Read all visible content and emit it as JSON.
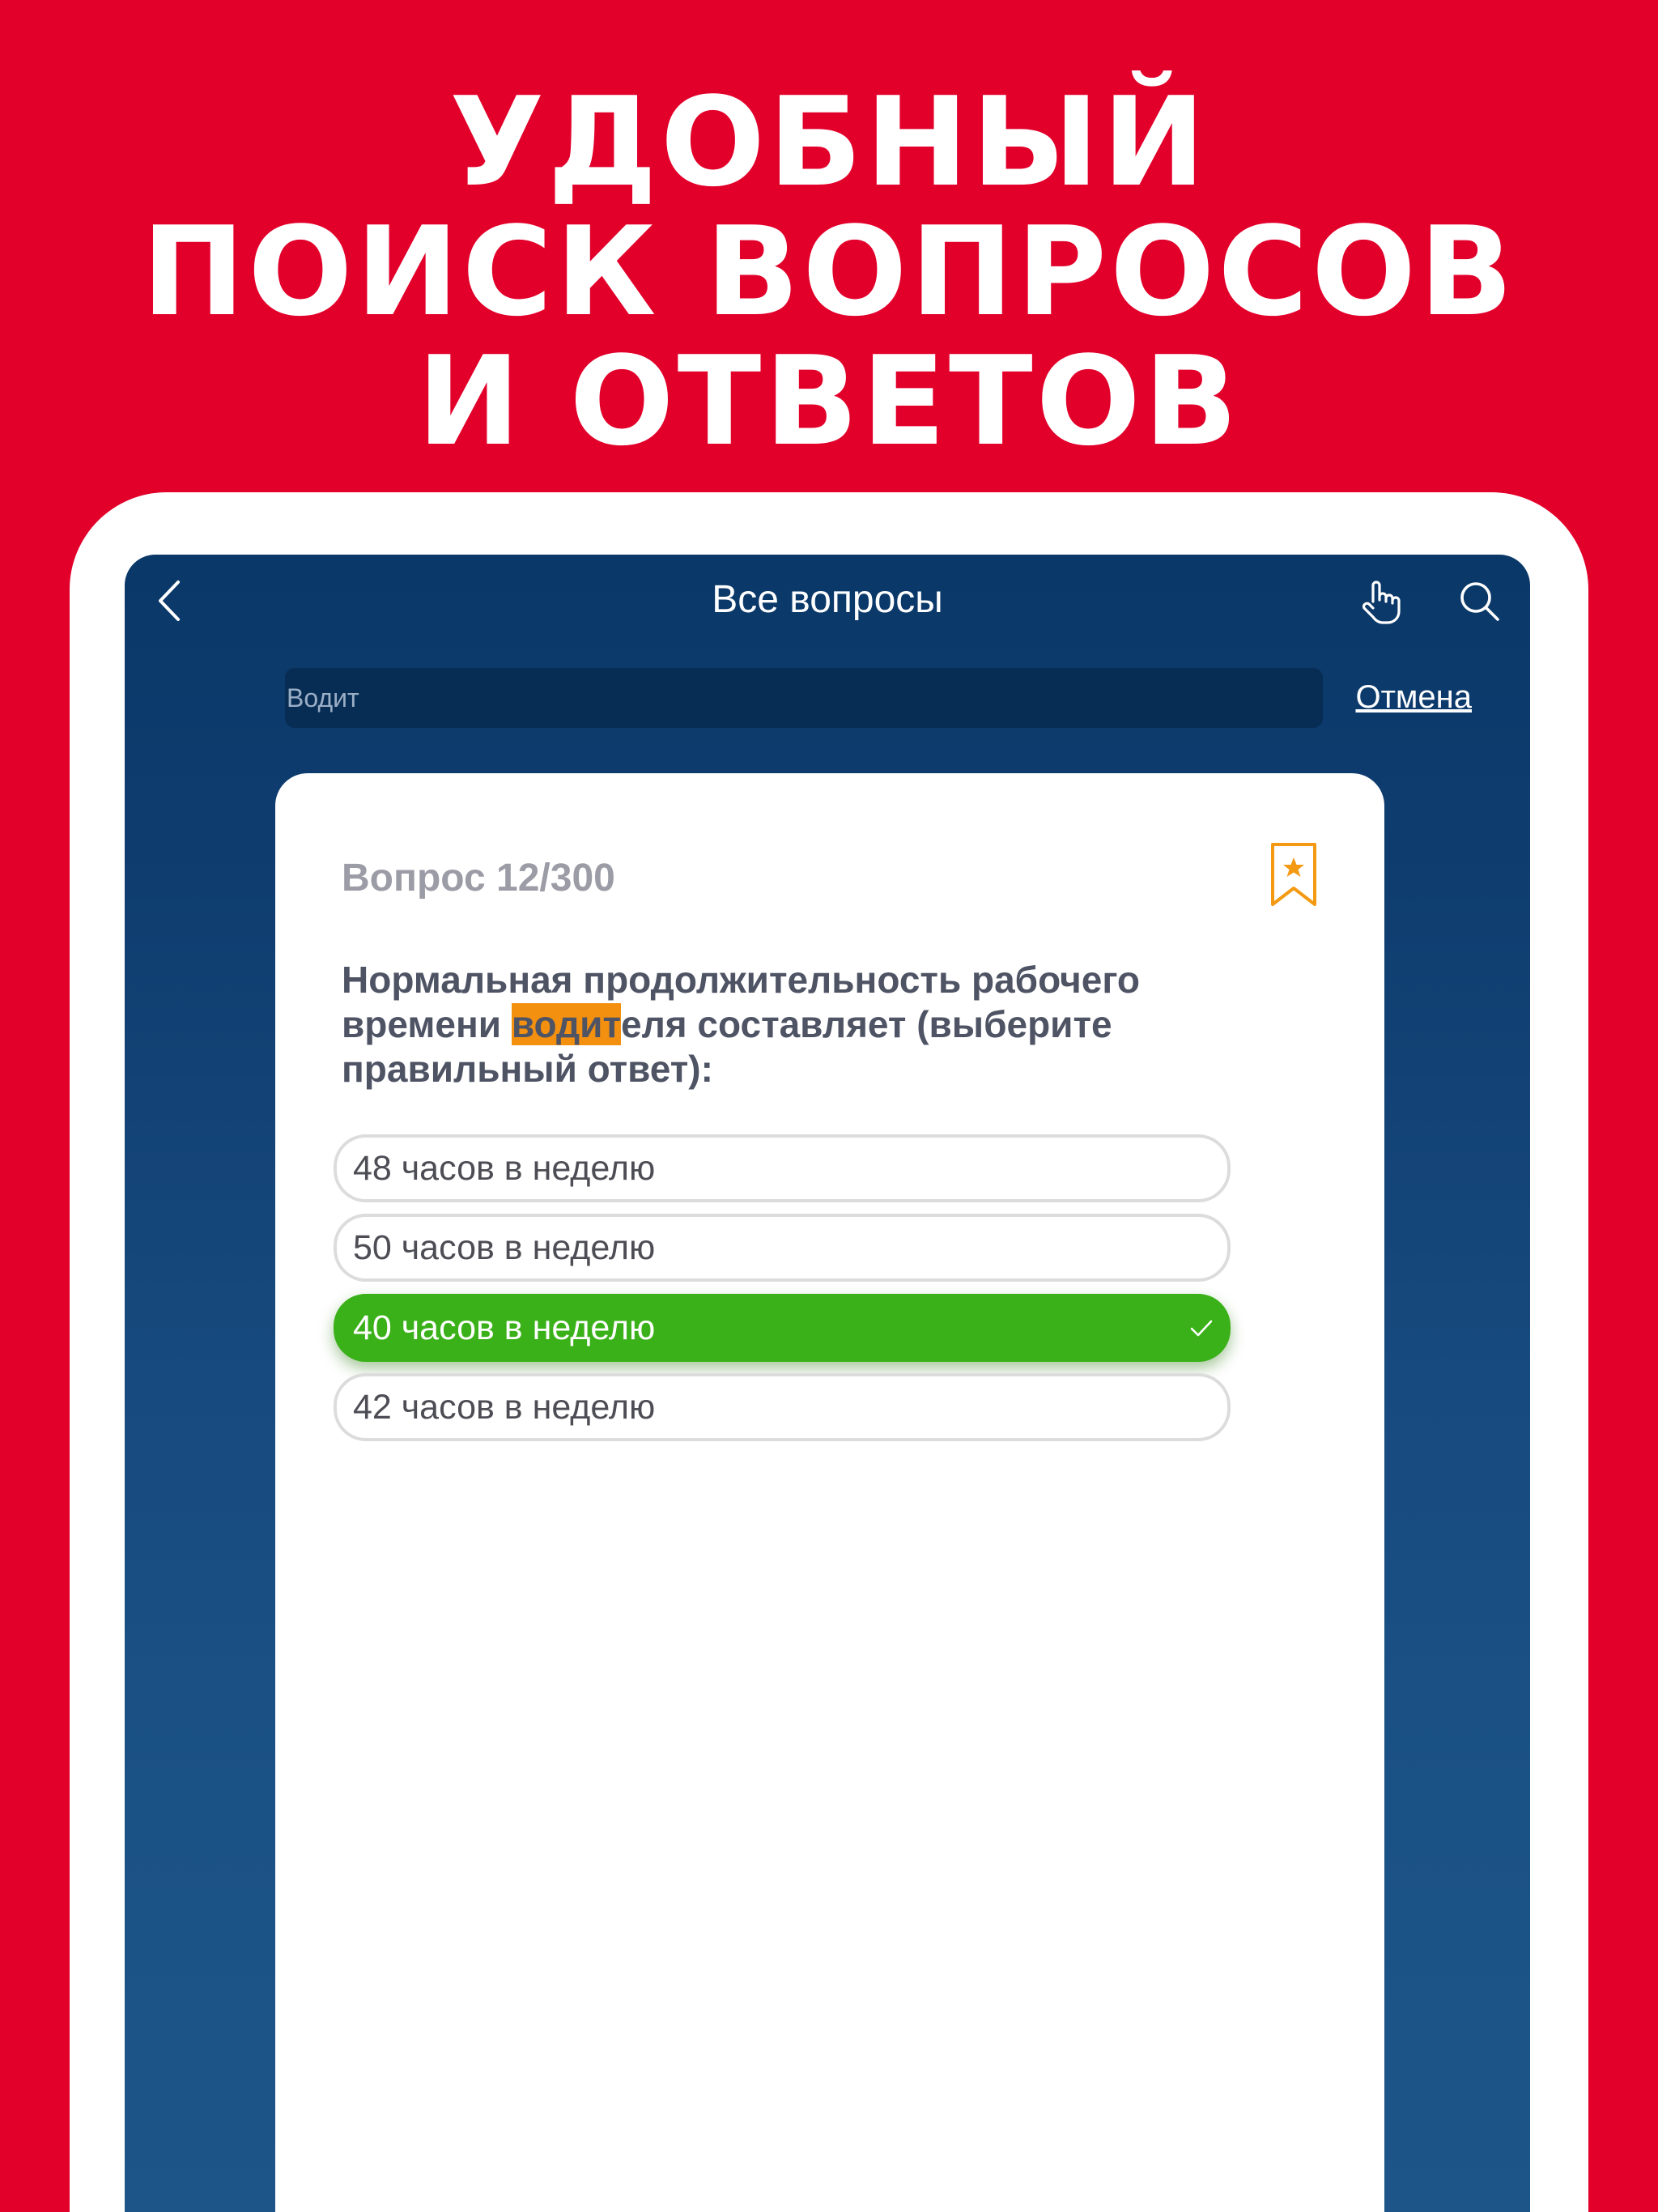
{
  "headline": {
    "line1": "УДОБНЫЙ",
    "line2": "ПОИСК ВОПРОСОВ",
    "line3": "И ОТВЕТОВ"
  },
  "nav": {
    "title": "Все вопросы",
    "back_icon": "chevron-left-icon",
    "hand_icon": "hand-pointer-icon",
    "search_icon": "search-icon"
  },
  "search": {
    "placeholder": "Водит",
    "cancel_label": "Отмена"
  },
  "question": {
    "number_label": "Вопрос 12/300",
    "bookmark_icon": "bookmark-star-icon",
    "text_before": "Нормальная продолжительность рабочего времени ",
    "text_highlight": "водит",
    "text_after": "еля составляет (выберите правильный ответ):",
    "answers": [
      {
        "label": "48 часов в неделю",
        "correct": false
      },
      {
        "label": "50 часов в неделю",
        "correct": false
      },
      {
        "label": "40 часов в неделю",
        "correct": true
      },
      {
        "label": "42 часов в неделю",
        "correct": false
      }
    ]
  },
  "colors": {
    "background_red": "#e2002b",
    "screen_navy": "#0f3d70",
    "highlight_orange": "#f39010",
    "correct_green": "#3ab118",
    "bookmark_orange": "#f39a12"
  }
}
